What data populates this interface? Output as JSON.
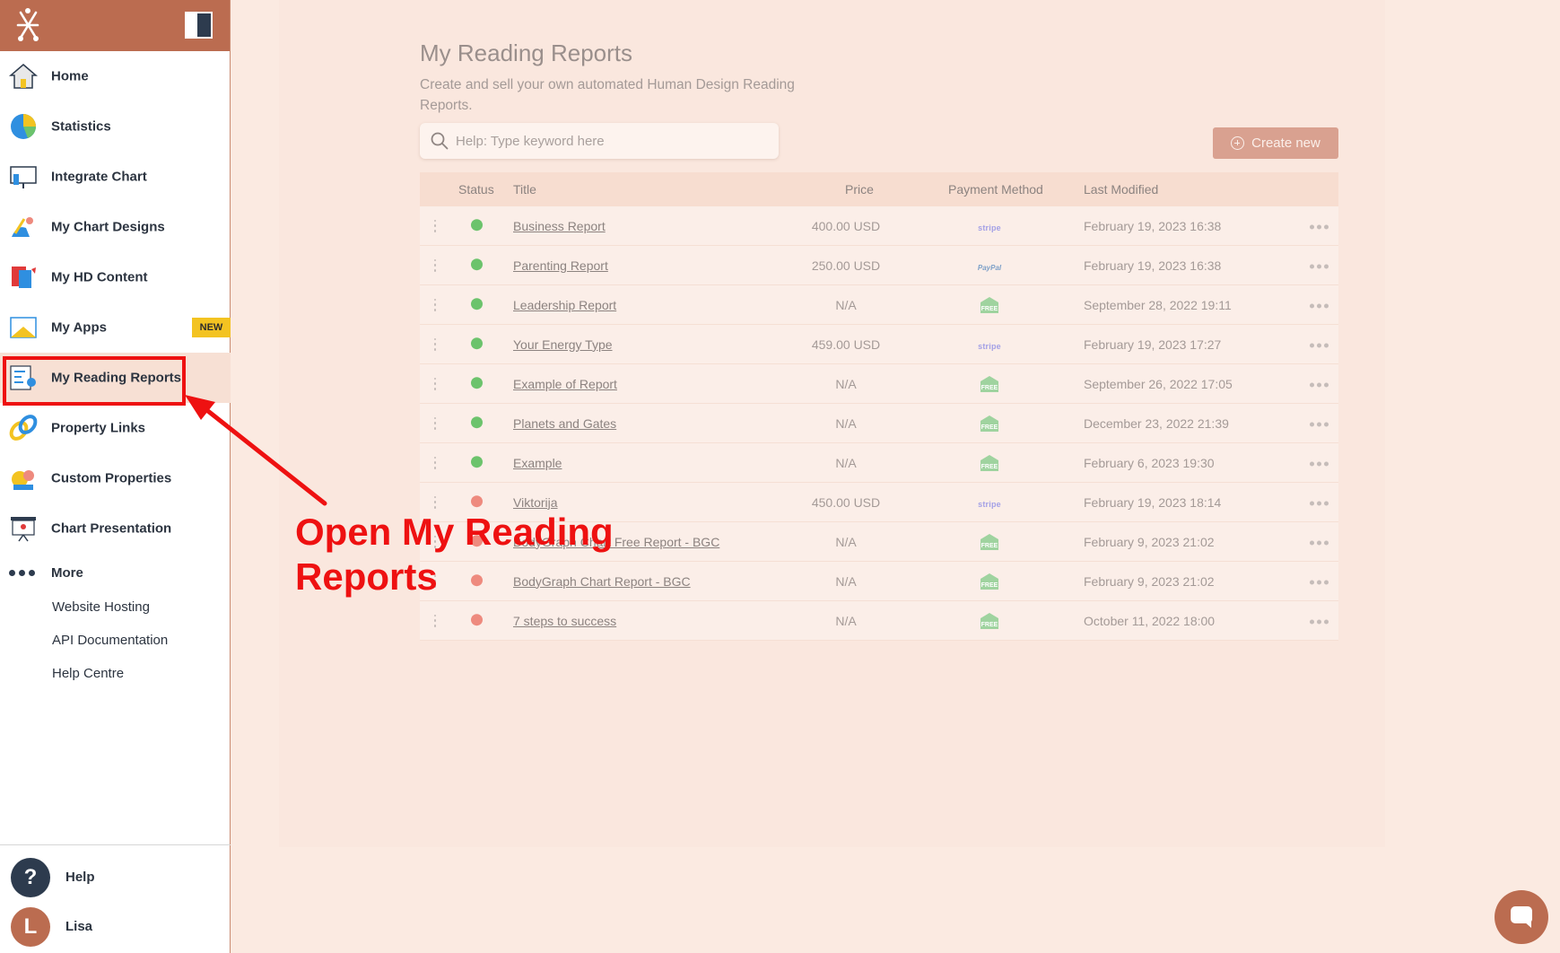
{
  "sidebar": {
    "items": [
      {
        "label": "Home",
        "icon": "home-icon"
      },
      {
        "label": "Statistics",
        "icon": "pie-chart-icon"
      },
      {
        "label": "Integrate Chart",
        "icon": "monitor-icon"
      },
      {
        "label": "My Chart Designs",
        "icon": "paint-icon"
      },
      {
        "label": "My HD Content",
        "icon": "content-icon"
      },
      {
        "label": "My Apps",
        "icon": "apps-icon",
        "badge": "NEW"
      },
      {
        "label": "My Reading Reports",
        "icon": "report-icon",
        "active": true
      },
      {
        "label": "Property Links",
        "icon": "link-icon"
      },
      {
        "label": "Custom Properties",
        "icon": "properties-icon"
      },
      {
        "label": "Chart Presentation",
        "icon": "presentation-icon"
      }
    ],
    "more_label": "More",
    "sub_links": [
      "Website Hosting",
      "API Documentation",
      "Help Centre"
    ],
    "help_label": "Help",
    "help_glyph": "?",
    "user_name": "Lisa",
    "user_initial": "L"
  },
  "main": {
    "title": "My Reading Reports",
    "subtitle": "Create and sell your own automated Human Design Reading Reports.",
    "search_placeholder": "Help: Type keyword here",
    "create_label": "Create new",
    "columns": [
      "Status",
      "Title",
      "Price",
      "Payment Method",
      "Last Modified"
    ],
    "rows": [
      {
        "status": "active",
        "title": "Business Report",
        "price": "400.00 USD",
        "payment": "stripe",
        "modified": "February 19, 2023 16:38"
      },
      {
        "status": "active",
        "title": "Parenting Report",
        "price": "250.00 USD",
        "payment": "PayPal",
        "modified": "February 19, 2023 16:38"
      },
      {
        "status": "active",
        "title": "Leadership Report",
        "price": "N/A",
        "payment": "FREE",
        "modified": "September 28, 2022 19:11"
      },
      {
        "status": "active",
        "title": "Your Energy Type",
        "price": "459.00 USD",
        "payment": "stripe",
        "modified": "February 19, 2023 17:27"
      },
      {
        "status": "active",
        "title": "Example of Report",
        "price": "N/A",
        "payment": "FREE",
        "modified": "September 26, 2022 17:05"
      },
      {
        "status": "active",
        "title": "Planets and Gates",
        "price": "N/A",
        "payment": "FREE",
        "modified": "December 23, 2022 21:39"
      },
      {
        "status": "active",
        "title": "Example",
        "price": "N/A",
        "payment": "FREE",
        "modified": "February 6, 2023 19:30"
      },
      {
        "status": "inactive",
        "title": "Viktorija",
        "price": "450.00 USD",
        "payment": "stripe",
        "modified": "February 19, 2023 18:14"
      },
      {
        "status": "inactive",
        "title": "BodyGraph Chart Free Report - BGC",
        "price": "N/A",
        "payment": "FREE",
        "modified": "February 9, 2023 21:02"
      },
      {
        "status": "inactive",
        "title": "BodyGraph Chart Report - BGC",
        "price": "N/A",
        "payment": "FREE",
        "modified": "February 9, 2023 21:02"
      },
      {
        "status": "inactive",
        "title": "7 steps to success",
        "price": "N/A",
        "payment": "FREE",
        "modified": "October 11, 2022 18:00"
      }
    ]
  },
  "annotation": {
    "text_line1": "Open My Reading",
    "text_line2": "Reports"
  },
  "colors": {
    "brand": "#bb6c50",
    "active_status": "#6cc36c",
    "inactive_status": "#ee8a7e",
    "annotation": "#ee1111"
  }
}
